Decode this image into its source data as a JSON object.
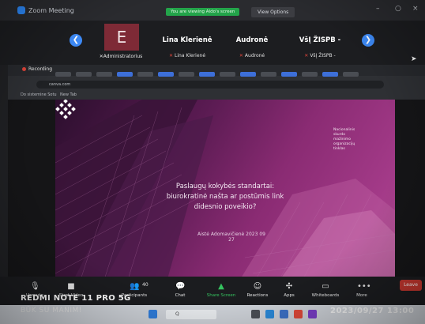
{
  "window": {
    "title": "Zoom Meeting",
    "view_banner": "You are viewing Aldo's screen",
    "view_options": "View Options"
  },
  "participants": {
    "nav_prev": "❮",
    "nav_next": "❯",
    "avatar_letter": "E",
    "admin_name": "Administratorius",
    "items": [
      {
        "name": "Lina Klerienė",
        "sub": "Lina Klerienė"
      },
      {
        "name": "Audronė",
        "sub": "Audronė"
      },
      {
        "name": "VšĮ ŽISPB -",
        "sub": "VšĮ ŽISPB -"
      }
    ]
  },
  "browser": {
    "recording_label": "Recording",
    "address": "canva.com",
    "bookmarks": [
      "Do sistemine Sotu",
      "New Tab"
    ]
  },
  "slide": {
    "title_line1": "Paslaugų kokybės standartai:",
    "title_line2": "biurokratinė našta ar postūmis link",
    "title_line3": "didesnio poveikio?",
    "author": "Aistė Adomavičienė 2023 09 27",
    "org_lines": [
      "Nacionalinis",
      "skurdo",
      "mažinimo",
      "organizacijų",
      "tinklas"
    ]
  },
  "toolbar": {
    "items": [
      {
        "label": "Unmute",
        "icon": "mic-icon"
      },
      {
        "label": "Start Video",
        "icon": "video-icon"
      },
      {
        "label": "Participants",
        "icon": "participants-icon",
        "count": "40"
      },
      {
        "label": "Chat",
        "icon": "chat-icon"
      },
      {
        "label": "Share Screen",
        "icon": "share-screen-icon"
      },
      {
        "label": "Reactions",
        "icon": "reactions-icon"
      },
      {
        "label": "Apps",
        "icon": "apps-icon"
      },
      {
        "label": "Whiteboards",
        "icon": "whiteboard-icon"
      },
      {
        "label": "More",
        "icon": "more-icon"
      }
    ],
    "leave": "Leave"
  },
  "taskbar": {
    "search_label": "Q"
  },
  "watermark": {
    "device": "REDMI NOTE 11 PRO 5G",
    "owner": "BŪK SU MANIM!",
    "timestamp": "2023/09/27 13:00"
  },
  "colors": {
    "zoom_blue": "#2d8cff",
    "share_green": "#35c25f",
    "leave_red": "#c7372f",
    "slide_purple": "#8a2b73"
  }
}
